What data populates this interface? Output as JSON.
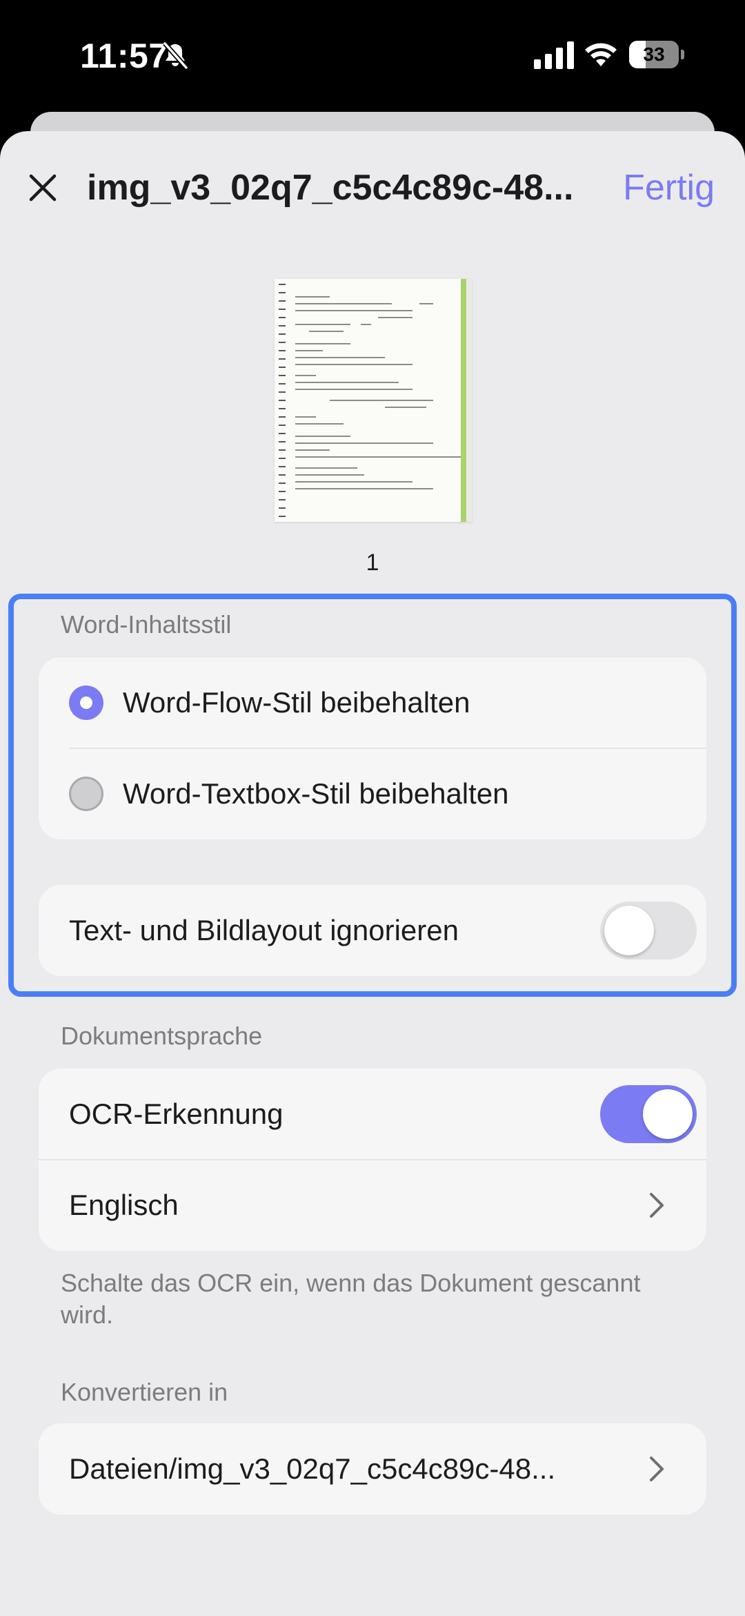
{
  "status": {
    "time": "11:57",
    "battery": "33",
    "battery_level": 0.33
  },
  "header": {
    "title": "img_v3_02q7_c5c4c89c-48...",
    "done_label": "Fertig"
  },
  "preview": {
    "page_number": "1"
  },
  "content_style": {
    "section_label": "Word-Inhaltsstil",
    "options": [
      {
        "label": "Word-Flow-Stil beibehalten",
        "selected": true
      },
      {
        "label": "Word-Textbox-Stil beibehalten",
        "selected": false
      }
    ],
    "ignore_layout": {
      "label": "Text- und Bildlayout ignorieren",
      "on": false
    }
  },
  "language": {
    "section_label": "Dokumentsprache",
    "ocr": {
      "label": "OCR-Erkennung",
      "on": true
    },
    "language_value": "Englisch",
    "help_text": "Schalte das OCR ein, wenn das Dokument gescannt wird."
  },
  "convert": {
    "section_label": "Konvertieren in",
    "path": "Dateien/img_v3_02q7_c5c4c89c-48..."
  },
  "colors": {
    "accent": "#7b7bf3",
    "highlight": "#4a7ff5"
  }
}
